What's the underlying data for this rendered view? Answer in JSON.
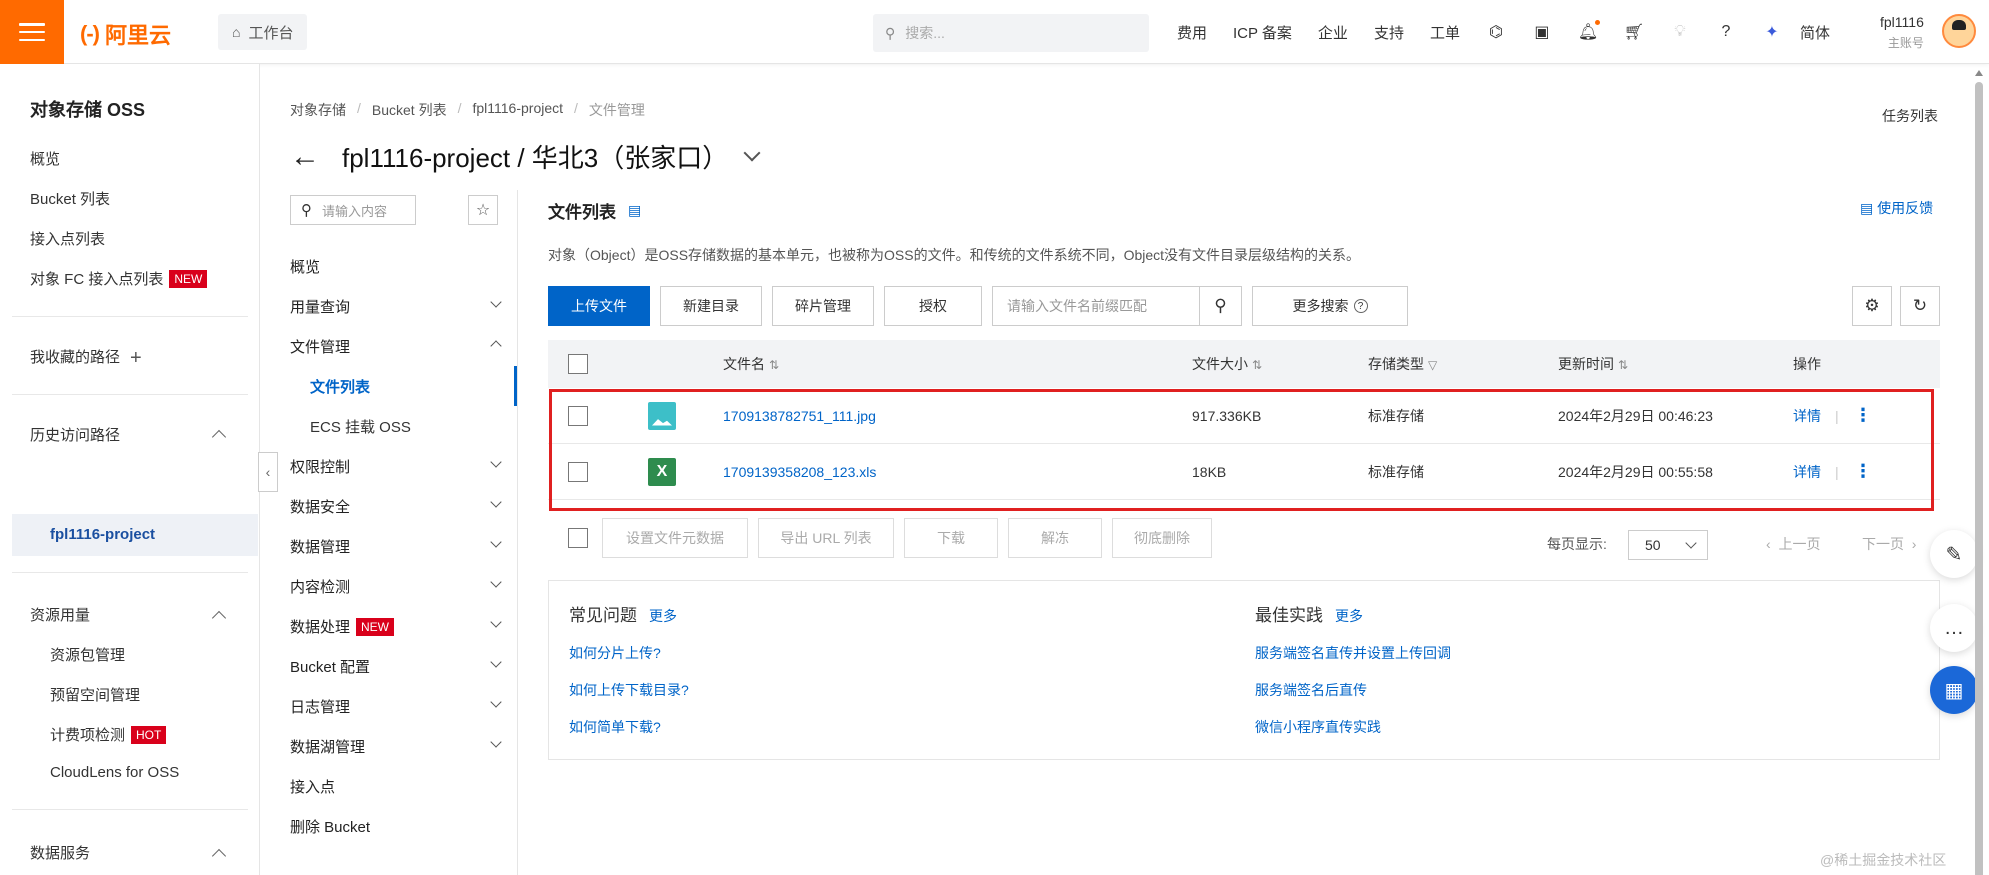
{
  "topbar": {
    "logo_text": "阿里云",
    "logo_mark": "(-)",
    "workbench": "工作台",
    "search_placeholder": "搜索...",
    "nav": [
      "费用",
      "ICP 备案",
      "企业",
      "支持",
      "工单"
    ],
    "lang": "简体",
    "user_name": "fpl1116",
    "user_role": "主账号"
  },
  "sidebar": {
    "title": "对象存储 OSS",
    "items": [
      "概览",
      "Bucket 列表",
      "接入点列表"
    ],
    "fc_item": "对象 FC 接入点列表",
    "new_badge": "NEW",
    "hot_badge": "HOT",
    "favorites": "我收藏的路径",
    "history": "历史访问路径",
    "history_active": "fpl1116-project",
    "resources": "资源用量",
    "resource_items": [
      "资源包管理",
      "预留空间管理",
      "计费项检测",
      "CloudLens for OSS"
    ],
    "data_service": "数据服务"
  },
  "breadcrumb": [
    "对象存储",
    "Bucket 列表",
    "fpl1116-project",
    "文件管理"
  ],
  "task_list": "任务列表",
  "page_title": "fpl1116-project / 华北3（张家口）",
  "secnav": {
    "search_placeholder": "请输入内容",
    "items": [
      {
        "label": "概览"
      },
      {
        "label": "用量查询"
      },
      {
        "label": "文件管理"
      },
      {
        "label": "文件列表"
      },
      {
        "label": "ECS 挂载 OSS"
      },
      {
        "label": "权限控制"
      },
      {
        "label": "数据安全"
      },
      {
        "label": "数据管理"
      },
      {
        "label": "内容检测"
      },
      {
        "label": "数据处理"
      },
      {
        "label": "Bucket 配置"
      },
      {
        "label": "日志管理"
      },
      {
        "label": "数据湖管理"
      },
      {
        "label": "接入点"
      },
      {
        "label": "删除 Bucket"
      }
    ]
  },
  "content": {
    "title": "文件列表",
    "feedback": "使用反馈",
    "description": "对象（Object）是OSS存储数据的基本单元，也被称为OSS的文件。和传统的文件系统不同，Object没有文件目录层级结构的关系。",
    "toolbar": {
      "upload": "上传文件",
      "new_dir": "新建目录",
      "fragments": "碎片管理",
      "authorize": "授权",
      "search_placeholder": "请输入文件名前缀匹配",
      "more_search": "更多搜索"
    },
    "columns": [
      "文件名",
      "文件大小",
      "存储类型",
      "更新时间",
      "操作"
    ],
    "rows": [
      {
        "name": "1709138782751_111.jpg",
        "size": "917.336KB",
        "type": "标准存储",
        "time": "2024年2月29日 00:46:23",
        "op": "详情",
        "icon": "image-file-icon"
      },
      {
        "name": "1709139358208_123.xls",
        "size": "18KB",
        "type": "标准存储",
        "time": "2024年2月29日 00:55:58",
        "op": "详情",
        "icon": "excel-file-icon"
      }
    ],
    "bulk": [
      "设置文件元数据",
      "导出 URL 列表",
      "下载",
      "解冻",
      "彻底删除"
    ],
    "per_page_label": "每页显示:",
    "per_page_value": "50",
    "prev": "上一页",
    "next": "下一页"
  },
  "faq": {
    "left_title": "常见问题",
    "right_title": "最佳实践",
    "more": "更多",
    "left_links": [
      "如何分片上传?",
      "如何上传下载目录?",
      "如何简单下载?"
    ],
    "right_links": [
      "服务端签名直传并设置上传回调",
      "服务端签名后直传",
      "微信小程序直传实践"
    ]
  },
  "watermark": "@稀土掘金技术社区",
  "colors": {
    "brand": "#ff6a00",
    "primary": "#0064c8",
    "highlight": "#e02020"
  }
}
